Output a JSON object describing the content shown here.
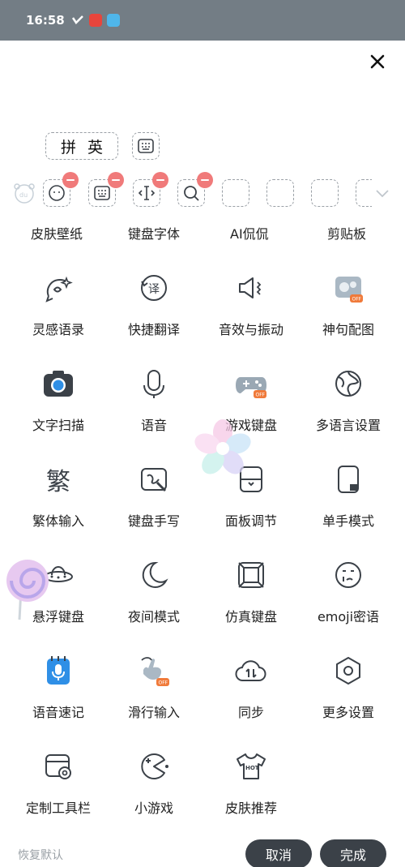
{
  "status_bar": {
    "time": "16:58"
  },
  "input_mode": {
    "pinyin": "拼",
    "english": "英"
  },
  "toolbar_labels": [
    "皮肤壁纸",
    "键盘字体",
    "AI侃侃",
    "剪贴板"
  ],
  "grid": [
    {
      "label": "灵感语录",
      "icon": "inspiration-icon"
    },
    {
      "label": "快捷翻译",
      "icon": "translate-icon"
    },
    {
      "label": "音效与振动",
      "icon": "sound-vibration-icon"
    },
    {
      "label": "神句配图",
      "icon": "meme-image-icon",
      "badge": "OFF"
    },
    {
      "label": "文字扫描",
      "icon": "camera-icon"
    },
    {
      "label": "语音",
      "icon": "microphone-icon"
    },
    {
      "label": "游戏键盘",
      "icon": "gamepad-icon",
      "badge": "OFF"
    },
    {
      "label": "多语言设置",
      "icon": "globe-icon"
    },
    {
      "label": "繁体输入",
      "icon": "traditional-char-icon",
      "glyph": "繁"
    },
    {
      "label": "键盘手写",
      "icon": "handwriting-icon"
    },
    {
      "label": "面板调节",
      "icon": "panel-adjust-icon"
    },
    {
      "label": "单手模式",
      "icon": "one-hand-icon"
    },
    {
      "label": "悬浮键盘",
      "icon": "ufo-icon"
    },
    {
      "label": "夜间模式",
      "icon": "moon-icon"
    },
    {
      "label": "仿真键盘",
      "icon": "simulated-keyboard-icon"
    },
    {
      "label": "emoji密语",
      "icon": "emoji-icon"
    },
    {
      "label": "语音速记",
      "icon": "voice-note-icon"
    },
    {
      "label": "滑行输入",
      "icon": "swipe-input-icon",
      "badge": "OFF"
    },
    {
      "label": "同步",
      "icon": "cloud-sync-icon"
    },
    {
      "label": "更多设置",
      "icon": "settings-icon"
    },
    {
      "label": "定制工具栏",
      "icon": "custom-toolbar-icon"
    },
    {
      "label": "小游戏",
      "icon": "minigame-icon"
    },
    {
      "label": "皮肤推荐",
      "icon": "tshirt-icon",
      "hot": "HOT"
    }
  ],
  "footer": {
    "restore": "恢复默认",
    "cancel": "取消",
    "done": "完成"
  },
  "colors": {
    "status_bar": "#737d85",
    "icon_stroke": "#3b4148",
    "minus_badge": "#f07a7a",
    "button_bg": "#3b4148",
    "accent_blue": "#2f8fe6",
    "off_badge": "#f07a3a"
  }
}
